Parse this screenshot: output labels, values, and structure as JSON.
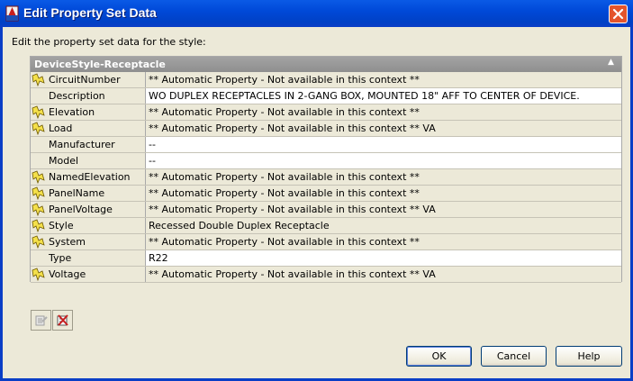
{
  "window": {
    "title": "Edit Property Set Data"
  },
  "instruction": "Edit the property set data for the style:",
  "group": {
    "name": "DeviceStyle-Receptacle"
  },
  "properties": [
    {
      "name": "CircuitNumber",
      "value": "** Automatic Property - Not available in this context **",
      "automatic": true
    },
    {
      "name": "Description",
      "value": "WO DUPLEX RECEPTACLES IN 2-GANG BOX, MOUNTED 18\" AFF TO CENTER OF DEVICE.",
      "automatic": false
    },
    {
      "name": "Elevation",
      "value": "** Automatic Property - Not available in this context **",
      "automatic": true
    },
    {
      "name": "Load",
      "value": "** Automatic Property - Not available in this context ** VA",
      "automatic": true
    },
    {
      "name": "Manufacturer",
      "value": "--",
      "automatic": false
    },
    {
      "name": "Model",
      "value": "--",
      "automatic": false
    },
    {
      "name": "NamedElevation",
      "value": "** Automatic Property - Not available in this context **",
      "automatic": true
    },
    {
      "name": "PanelName",
      "value": "** Automatic Property - Not available in this context **",
      "automatic": true
    },
    {
      "name": "PanelVoltage",
      "value": "** Automatic Property - Not available in this context ** VA",
      "automatic": true
    },
    {
      "name": "Style",
      "value": "Recessed Double Duplex Receptacle",
      "automatic": true
    },
    {
      "name": "System",
      "value": "** Automatic Property - Not available in this context **",
      "automatic": true
    },
    {
      "name": "Type",
      "value": "R22",
      "automatic": false
    },
    {
      "name": "Voltage",
      "value": "** Automatic Property - Not available in this context ** VA",
      "automatic": true
    }
  ],
  "buttons": {
    "ok": "OK",
    "cancel": "Cancel",
    "help": "Help"
  },
  "colors": {
    "titlebar": "#0a4fd6",
    "close": "#e4542c",
    "dialog": "#ece9d8",
    "group_header": "#999999"
  }
}
